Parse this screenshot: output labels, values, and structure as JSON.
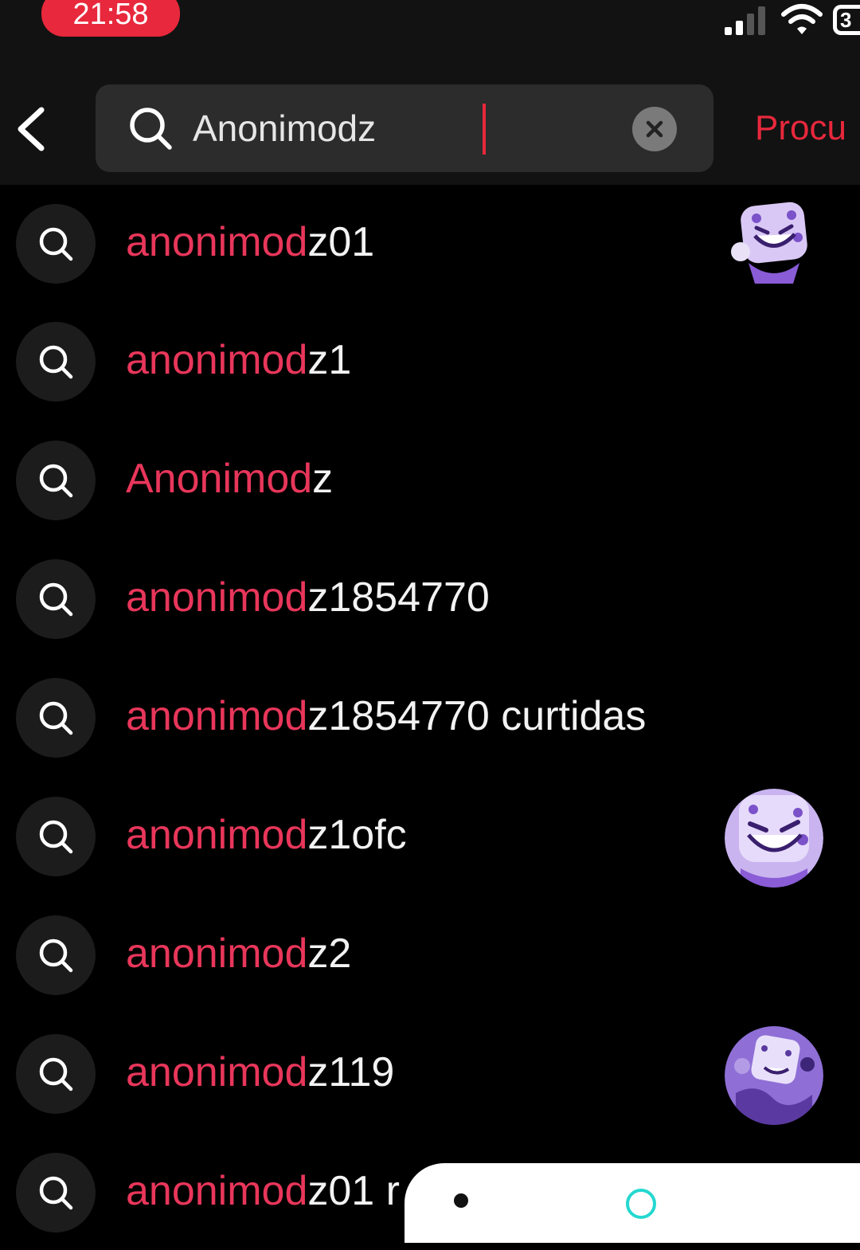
{
  "status_bar": {
    "time": "21:58",
    "battery_label": "3"
  },
  "header": {
    "search_query": "Anonimodz",
    "search_action_label": "Procu"
  },
  "suggestions": [
    {
      "match": "anonimod",
      "rest": "z01",
      "has_avatar": true
    },
    {
      "match": "anonimod",
      "rest": "z1",
      "has_avatar": false
    },
    {
      "match": "Anonimod",
      "rest": "z",
      "has_avatar": false
    },
    {
      "match": "anonimod",
      "rest": "z1854770",
      "has_avatar": false
    },
    {
      "match": "anonimod",
      "rest": "z1854770 curtidas",
      "has_avatar": false
    },
    {
      "match": "anonimod",
      "rest": "z1ofc",
      "has_avatar": true
    },
    {
      "match": "anonimod",
      "rest": "z2",
      "has_avatar": false
    },
    {
      "match": "anonimod",
      "rest": "z119",
      "has_avatar": true
    },
    {
      "match": "anonimod",
      "rest": "z01 r",
      "has_avatar": false
    }
  ],
  "colors": {
    "accent": "#e8283c",
    "match_text": "#e8365a",
    "background": "#000000",
    "avatar_purple": "#8f6fd6"
  },
  "icons": {
    "back": "chevron-left-icon",
    "search": "search-icon",
    "clear": "close-icon",
    "avatar": "dice-character-avatar"
  }
}
